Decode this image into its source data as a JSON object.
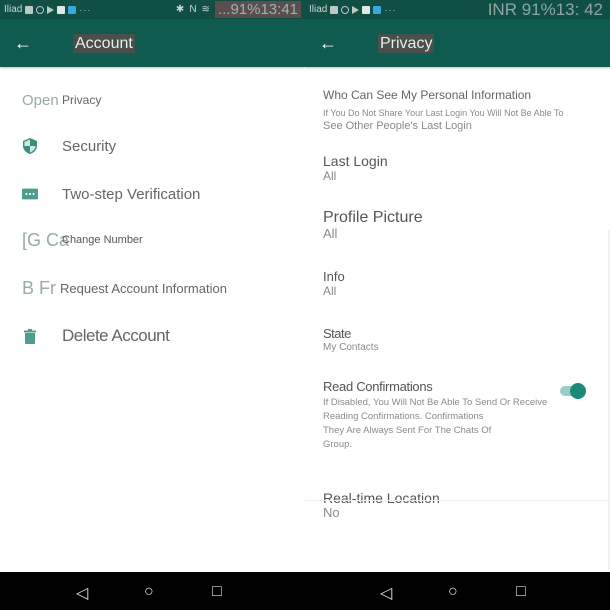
{
  "left_screen": {
    "statusbar": {
      "carrier": "Iliad",
      "dots": "···",
      "bluetooth": "✱",
      "nfc": "N",
      "wifi": "≋",
      "status_time": "...91%13:41"
    },
    "toolbar": {
      "back_icon": "←",
      "title": "Account"
    },
    "items": [
      {
        "icon": "lock-icon",
        "ghost": "Open",
        "label": "Privacy"
      },
      {
        "icon": "shield-icon",
        "label": "Security"
      },
      {
        "icon": "dots-icon",
        "label": "Two-step Verification"
      },
      {
        "icon": "phone-icon",
        "ghost": "[G Ca",
        "label": "Change Number"
      },
      {
        "icon": "document-icon",
        "ghost": "B Fr",
        "label": "Request Account Information"
      },
      {
        "icon": "trash-icon",
        "label": "Delete Account"
      }
    ]
  },
  "right_screen": {
    "statusbar": {
      "carrier": "Iliad",
      "dots": "···",
      "status_time": "INR 91%13: 42"
    },
    "toolbar": {
      "back_icon": "←",
      "title": "Privacy"
    },
    "section_header": "Who Can See My Personal Information",
    "section_note_1": "If You Do Not Share Your Last Login You Will Not Be Able To",
    "section_note_2": "See Other People's Last Login",
    "items": [
      {
        "title": "Last Login",
        "value": "All"
      },
      {
        "title": "Profile Picture",
        "value": "All"
      },
      {
        "title": "Info",
        "value": "All"
      },
      {
        "title": "State",
        "value": "My Contacts"
      }
    ],
    "read_confirmations": {
      "title": "Read Confirmations",
      "desc_1": "If Disabled, You Will Not Be Able To Send Or Receive",
      "desc_2": "Reading Confirmations. Confirmations",
      "desc_3": "They Are Always Sent For The Chats Of",
      "desc_4": "Group.",
      "enabled": true
    },
    "realtime_location": {
      "title": "Real-time Location",
      "value": "No"
    }
  },
  "navbar": {
    "back": "◁",
    "home": "○",
    "recents": "□"
  },
  "colors": {
    "statusbar": "#0f4f44",
    "toolbar": "#0f5b4f",
    "accent": "#1b8a78",
    "icon": "#3c8f80"
  }
}
